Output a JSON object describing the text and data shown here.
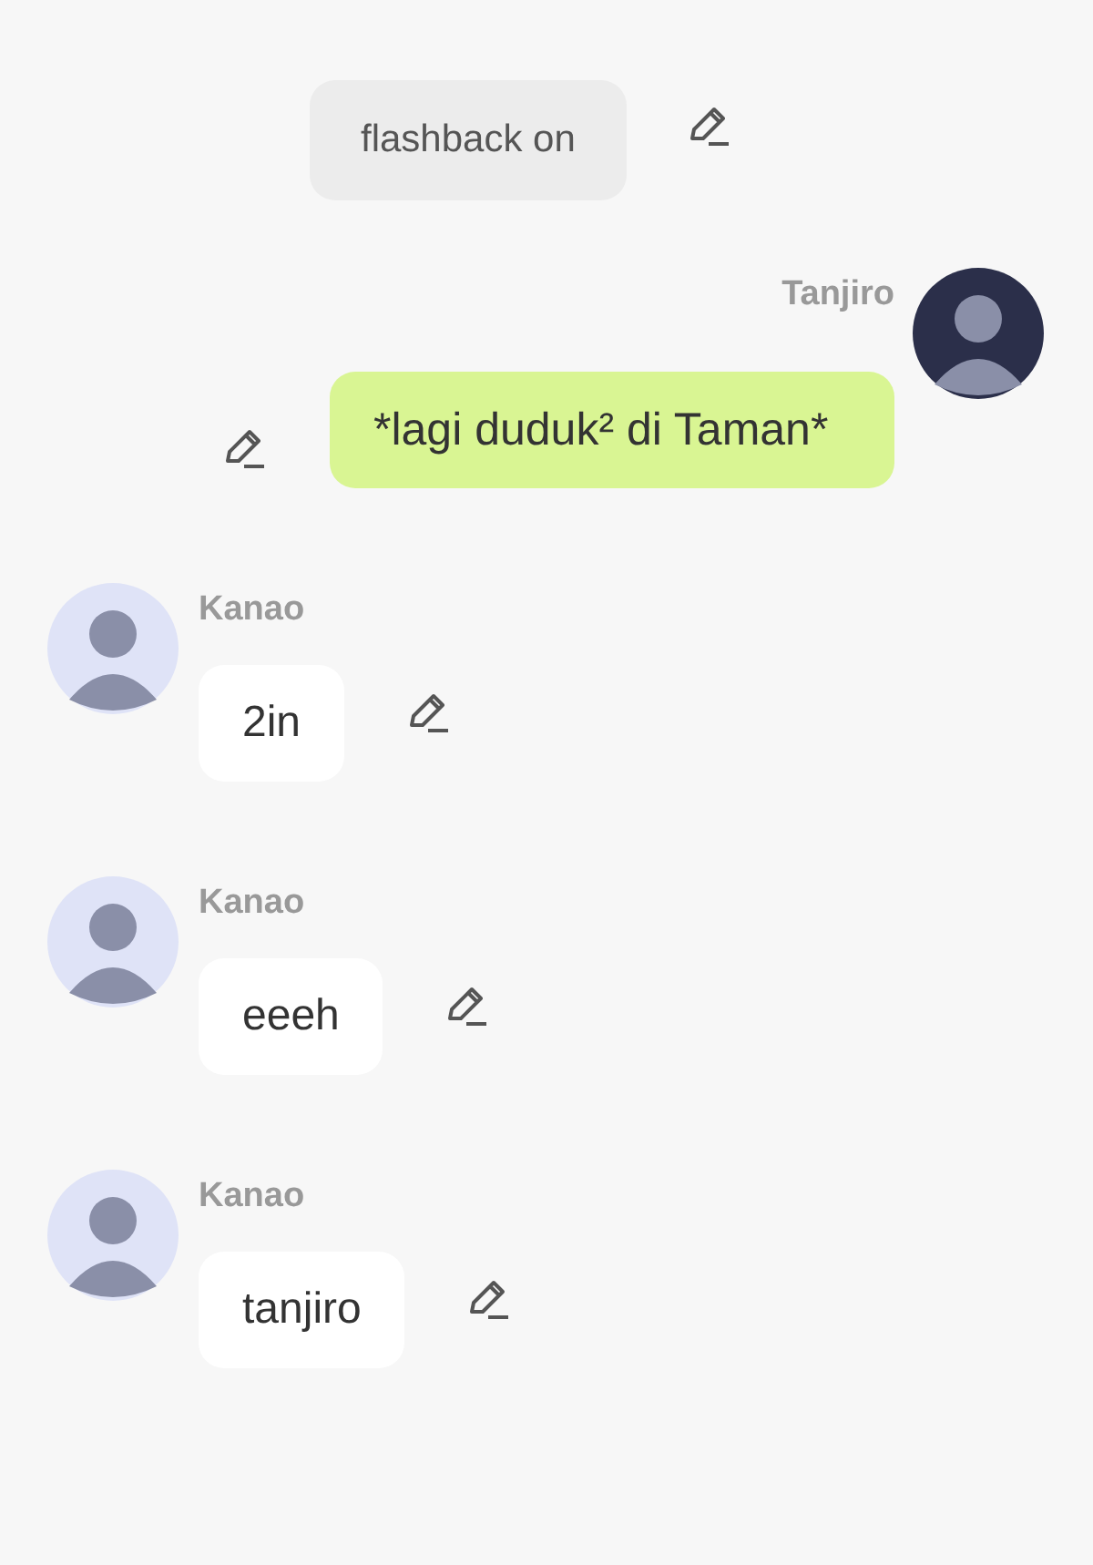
{
  "messages": [
    {
      "kind": "system",
      "text": "flashback on"
    },
    {
      "kind": "outgoing",
      "sender": "Tanjiro",
      "color": "#2b2f4a",
      "text": "*lagi duduk² di Taman*"
    },
    {
      "kind": "incoming",
      "sender": "Kanao",
      "color": "#dfe3f7",
      "text": "2in"
    },
    {
      "kind": "incoming",
      "sender": "Kanao",
      "color": "#dfe3f7",
      "text": "eeeh"
    },
    {
      "kind": "incoming",
      "sender": "Kanao",
      "color": "#dfe3f7",
      "text": "tanjiro"
    }
  ]
}
